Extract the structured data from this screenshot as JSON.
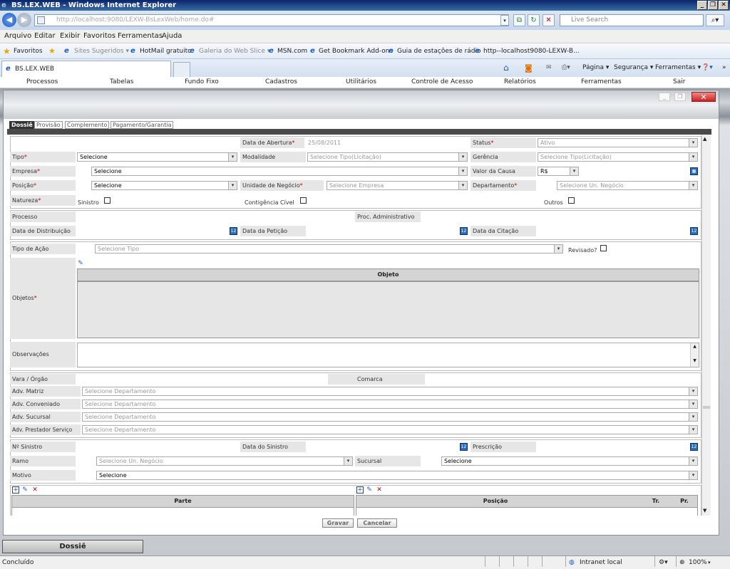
{
  "window": {
    "title": "BS.LEX.WEB - Windows Internet Explorer"
  },
  "address": {
    "url": "http://localhost:9080/LEXW-BsLexWeb/home.do#",
    "search_placeholder": "Live Search"
  },
  "menu": [
    "Arquivo",
    "Editar",
    "Exibir",
    "Favoritos",
    "Ferramentas",
    "Ajuda"
  ],
  "favorites": {
    "label": "Favoritos",
    "items": [
      "Sites Sugeridos ▾",
      "HotMail gratuito",
      "Galeria do Web Slice ▾",
      "MSN.com",
      "Get Bookmark Add-ons",
      "Guia de estações de rádio",
      "http--localhost9080-LEXW-B..."
    ]
  },
  "tab": {
    "title": "BS.LEX.WEB"
  },
  "tabtools": {
    "pagina": "Página ▾",
    "seguranca": "Segurança ▾",
    "ferramentas": "Ferramentas ▾",
    "help": "❓▾"
  },
  "appmenu": [
    "Processos",
    "Tabelas",
    "Fundo Fixo",
    "Cadastros",
    "Utilitários",
    "Controle de Acesso",
    "Relatórios",
    "Ferramentas",
    "Sair"
  ],
  "formtabs": [
    "Dossiê",
    "Provisão",
    "Complemento",
    "Pagamento/Garantia"
  ],
  "labels": {
    "data_abertura": "Data de Abertura",
    "status": "Status",
    "tipo": "Tipo",
    "modalidade": "Modalidade",
    "gerencia": "Gerência",
    "empresa": "Empresa",
    "valor_causa": "Valor da Causa",
    "posicao": "Posição",
    "unidade_negocio": "Unidade de Negócio",
    "departamento": "Departamento",
    "natureza": "Natureza",
    "sinistro": "Sinistro",
    "contingencia": "Contigência Cível",
    "outros": "Outros",
    "processo": "Processo",
    "proc_admin": "Proc. Administrativo",
    "data_distribuicao": "Data de Distribuição",
    "data_peticao": "Data da Petição",
    "data_citacao": "Data da Citação",
    "tipo_acao": "Tipo de Ação",
    "revisado": "Revisado?",
    "objetos": "Objetos",
    "objeto_col": "Objeto",
    "observacoes": "Observações",
    "vara": "Vara / Órgão",
    "comarca": "Comarca",
    "adv_matriz": "Adv. Matriz",
    "adv_conveniado": "Adv. Conveniado",
    "adv_sucursal": "Adv. Sucursal",
    "adv_prestador": "Adv. Prestador Serviço",
    "n_sinistro": "Nº Sinistro",
    "data_sinistro": "Data do Sinistro",
    "prescricao": "Prescrição",
    "ramo": "Ramo",
    "sucursal": "Sucursal",
    "motivo": "Motivo",
    "parte_col": "Parte",
    "posicao_col": "Posição",
    "tr_col": "Tr.",
    "pr_col": "Pr."
  },
  "values": {
    "data_abertura": "25/08/2011",
    "status": "Ativo",
    "tipo": "Selecione",
    "modalidade": "Selecione Tipo(Licitação)",
    "gerencia": "Selecione Tipo(Licitação)",
    "empresa": "Selecione",
    "moeda": "R$",
    "posicao": "Selecione",
    "unidade_negocio": "Selecione Empresa",
    "departamento": "Selecione Un. Negócio",
    "tipo_acao": "Selecione Tipo",
    "adv": "Selecione Departamento",
    "ramo": "Selecione Un. Negócio",
    "sucursal": "Selecione",
    "motivo": "Selecione"
  },
  "buttons": {
    "gravar": "Gravar",
    "cancelar": "Cancelar"
  },
  "taskbar": {
    "dossie": "Dossiê"
  },
  "status": {
    "text": "Concluído",
    "zone": "Intranet local",
    "zoom": "100%"
  }
}
